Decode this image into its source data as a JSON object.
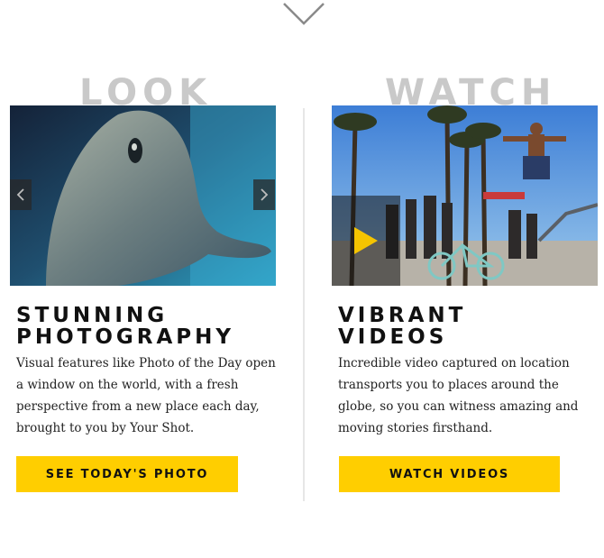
{
  "icons": {
    "scroll_down": "chevron-down-icon",
    "gallery_prev": "chevron-left-icon",
    "gallery_next": "chevron-right-icon",
    "video_play": "play-icon"
  },
  "colors": {
    "accent": "#ffce00",
    "label_gray": "#c9c9c9",
    "text": "#111111",
    "divider": "#e6e6e6"
  },
  "look": {
    "section_label": "LOOK",
    "heading_line1": "STUNNING",
    "heading_line2": "PHOTOGRAPHY",
    "body": "Visual features like Photo of the Day open a window on the world, with a fresh perspective from a new place each day, brought to you by Your Shot.",
    "button_label": "SEE TODAY'S PHOTO"
  },
  "watch": {
    "section_label": "WATCH",
    "heading_line1": "VIBRANT",
    "heading_line2": "VIDEOS",
    "body": "Incredible video captured on location transports you to places around the globe, so you can witness amazing and moving stories firsthand.",
    "button_label": "WATCH VIDEOS"
  }
}
